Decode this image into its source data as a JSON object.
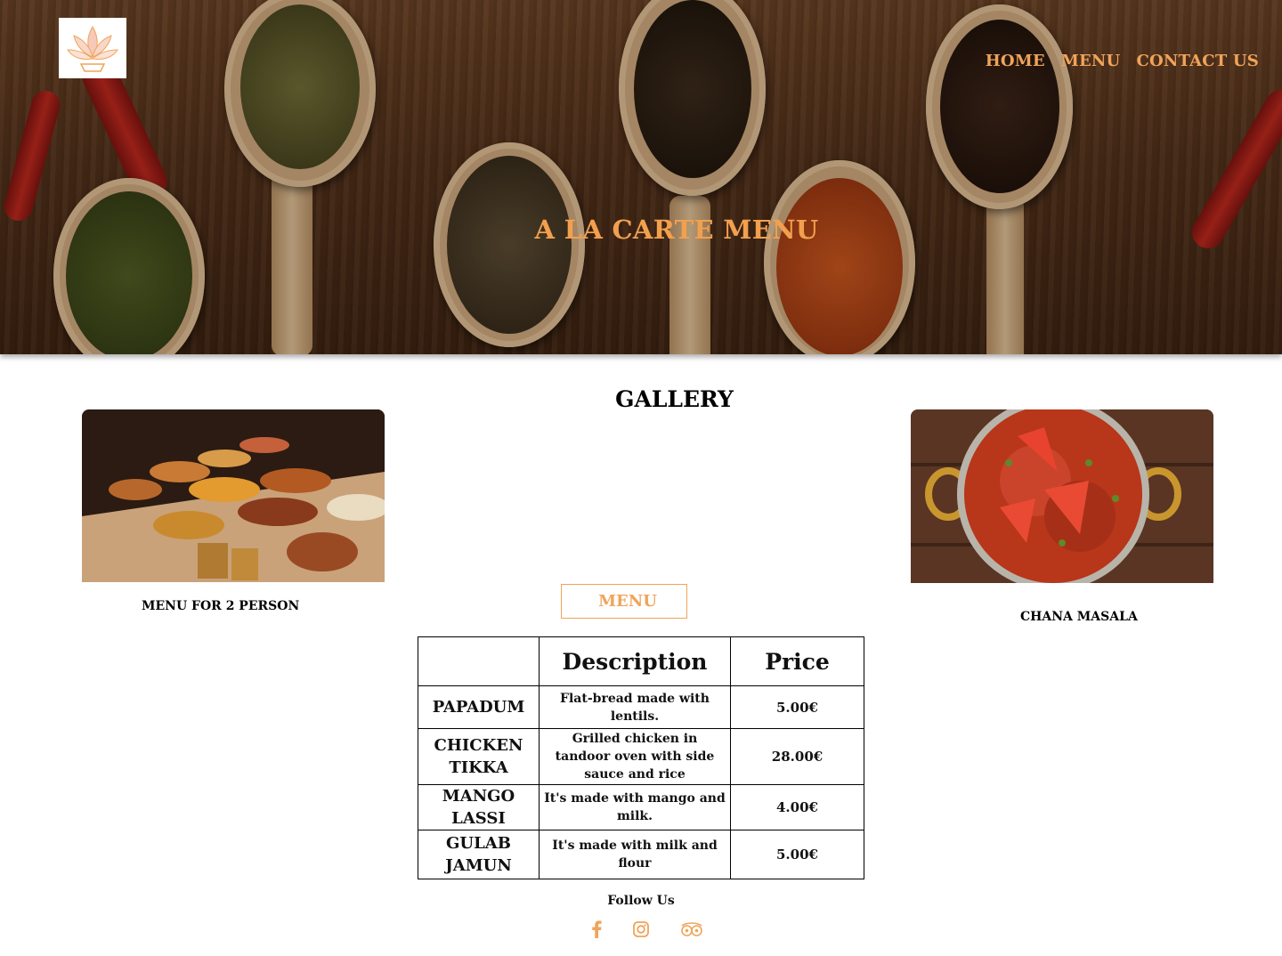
{
  "header": {
    "logo_alt": "lotus-logo",
    "nav": [
      {
        "label": "HOME"
      },
      {
        "label": "MENU"
      },
      {
        "label": "CONTACT US"
      }
    ],
    "hero_title": "A  LA CARTE MENU"
  },
  "gallery": {
    "title": "GALLERY",
    "left_caption": "MENU FOR 2 PERSON",
    "right_caption": "CHANA MASALA",
    "menu_button": "MENU"
  },
  "menu_table": {
    "headers": [
      "",
      "Description",
      "Price"
    ],
    "rows": [
      {
        "item": "PAPADUM",
        "description": "Flat-bread made with lentils.",
        "price": "5.00€"
      },
      {
        "item": "CHICKEN TIKKA",
        "description": "Grilled chicken in tandoor oven with side sauce and rice",
        "price": "28.00€"
      },
      {
        "item": "MANGO LASSI",
        "description": "It's made with mango and milk.",
        "price": "4.00€"
      },
      {
        "item": "GULAB JAMUN",
        "description": "It's made with milk and flour",
        "price": "5.00€"
      }
    ]
  },
  "footer": {
    "follow_label": "Follow Us",
    "social": [
      "facebook-icon",
      "instagram-icon",
      "tripadvisor-icon"
    ]
  },
  "colors": {
    "accent": "#f0a45a",
    "text": "#000000"
  }
}
